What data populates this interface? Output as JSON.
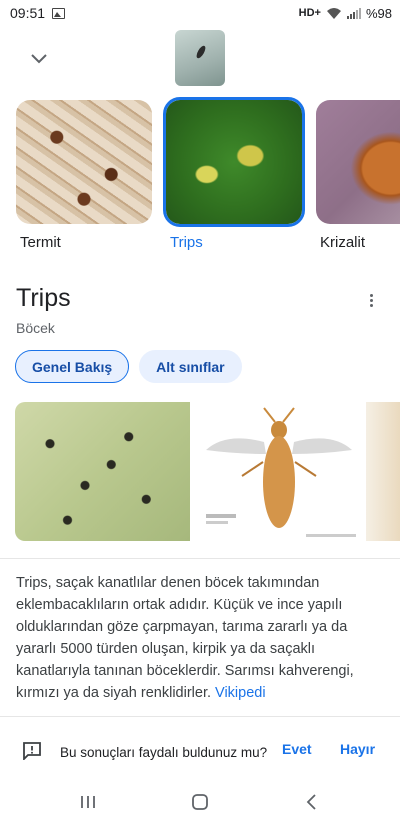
{
  "status_bar": {
    "time": "09:51",
    "network": "HD+",
    "battery": "%98"
  },
  "carousel": {
    "items": [
      {
        "label": "Termit",
        "selected": false
      },
      {
        "label": "Trips",
        "selected": true
      },
      {
        "label": "Krizalit",
        "selected": false
      }
    ]
  },
  "entity": {
    "title": "Trips",
    "subtitle": "Böcek"
  },
  "chips": {
    "overview": "Genel Bakış",
    "subclasses": "Alt sınıflar"
  },
  "description": {
    "text": "Trips, saçak kanatlılar denen böcek takımından eklembacaklıların ortak adıdır. Küçük ve ince yapılı olduklarından göze çarpmayan, tarıma zararlı ya da yararlı 5000 türden oluşan, kirpik ya da saçaklı kanatlarıyla tanınan böceklerdir. Sarımsı kahverengi, kırmızı ya da siyah renklidirler.",
    "source_link": "Vikipedi"
  },
  "feedback": {
    "question": "Bu sonuçları faydalı buldunuz mu?",
    "yes": "Evet",
    "no": "Hayır"
  },
  "colors": {
    "accent": "#1a73e8",
    "chip_bg": "#e8f0fe",
    "text_primary": "#202124",
    "text_secondary": "#5f6368"
  },
  "icons": [
    "chevron-down-icon",
    "more-vert-icon",
    "feedback-icon",
    "recents-icon",
    "home-icon",
    "back-icon",
    "wifi-icon",
    "signal-icon",
    "gallery-icon"
  ]
}
